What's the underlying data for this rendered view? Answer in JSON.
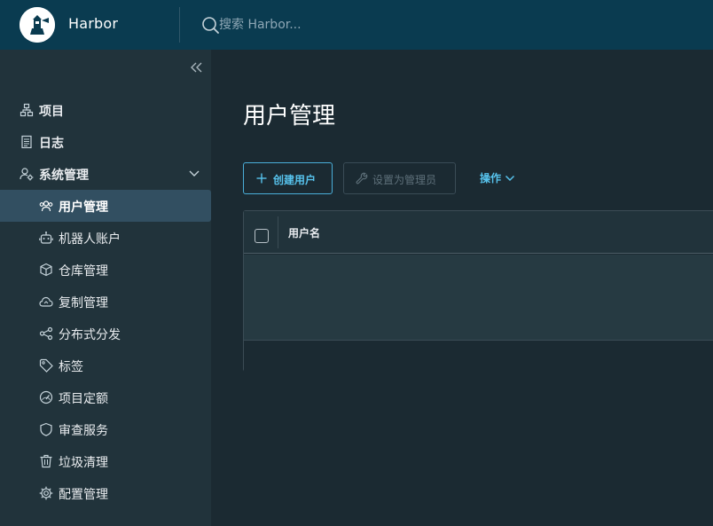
{
  "header": {
    "app_title": "Harbor",
    "search_placeholder": "搜索 Harbor..."
  },
  "sidebar": {
    "top_items": [
      {
        "label": "项目",
        "icon": "project-icon"
      },
      {
        "label": "日志",
        "icon": "log-icon"
      },
      {
        "label": "系统管理",
        "icon": "admin-icon",
        "expanded": true
      }
    ],
    "sub_items": [
      {
        "label": "用户管理",
        "icon": "users-icon",
        "active": true
      },
      {
        "label": "机器人账户",
        "icon": "robot-icon"
      },
      {
        "label": "仓库管理",
        "icon": "box-icon"
      },
      {
        "label": "复制管理",
        "icon": "cloud-icon"
      },
      {
        "label": "分布式分发",
        "icon": "share-icon"
      },
      {
        "label": "标签",
        "icon": "tag-icon"
      },
      {
        "label": "项目定额",
        "icon": "gauge-icon"
      },
      {
        "label": "审查服务",
        "icon": "shield-icon"
      },
      {
        "label": "垃圾清理",
        "icon": "trash-icon"
      },
      {
        "label": "配置管理",
        "icon": "gear-icon"
      }
    ]
  },
  "main": {
    "title": "用户管理",
    "create_user_label": "创建用户",
    "set_admin_label": "设置为管理员",
    "actions_label": "操作",
    "table": {
      "columns": [
        "用户名"
      ]
    }
  },
  "colors": {
    "header_bg": "#0a3b50",
    "sidebar_bg": "#21333b",
    "main_bg": "#1b2a32",
    "accent": "#57c3ed",
    "active_item_bg": "#324f61"
  }
}
